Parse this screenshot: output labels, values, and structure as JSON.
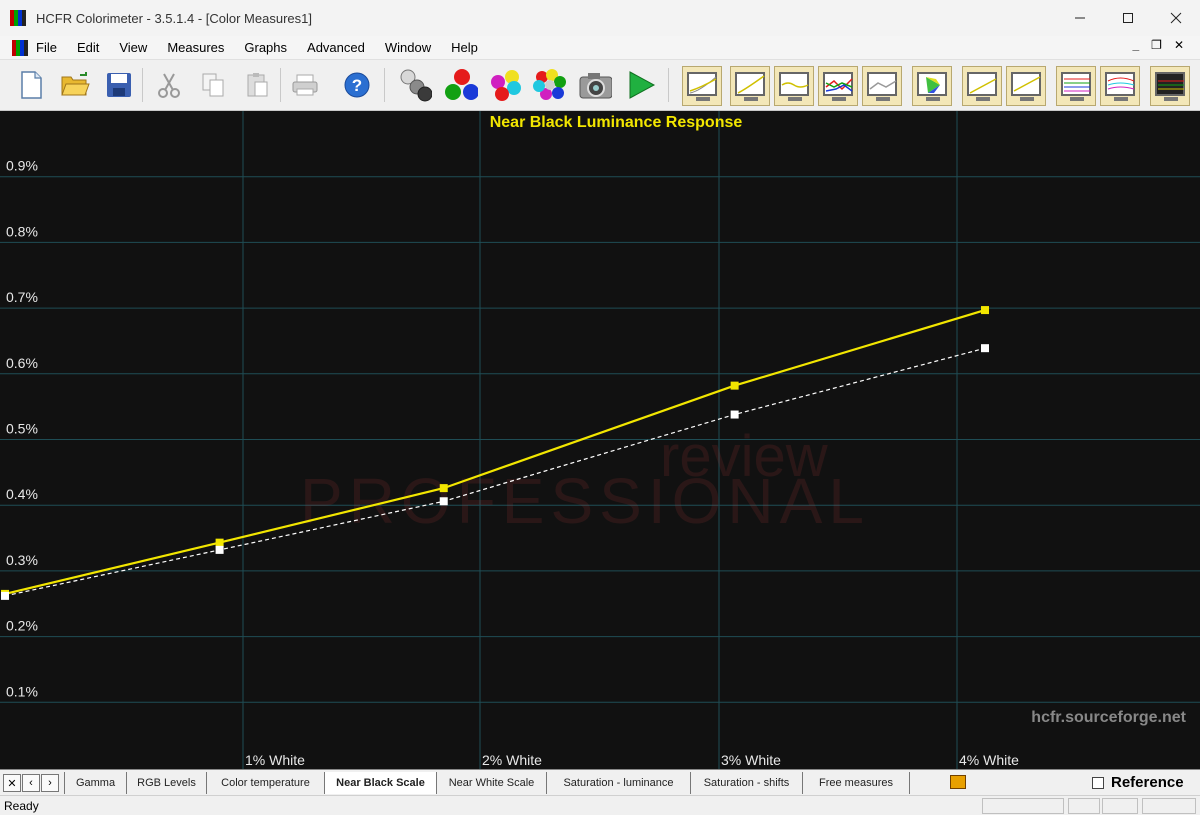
{
  "window": {
    "title": "HCFR Colorimeter - 3.5.1.4 - [Color Measures1]",
    "controls": [
      "minimize-icon",
      "maximize-icon",
      "close-icon"
    ]
  },
  "menu": {
    "items": [
      "File",
      "Edit",
      "View",
      "Measures",
      "Graphs",
      "Advanced",
      "Window",
      "Help"
    ]
  },
  "toolbar": {
    "buttons": [
      "new-icon",
      "open-icon",
      "save-icon",
      "cut-icon",
      "copy-icon",
      "paste-icon",
      "print-icon",
      "help-icon",
      "grayscale-measure-icon",
      "primary-colors-icon",
      "secondary-colors-icon",
      "all-colors-icon",
      "camera-icon",
      "play-icon"
    ],
    "graph_buttons": [
      "gamma-graph-icon",
      "luminance-graph-icon",
      "color-temp-graph-icon",
      "rgb-levels-graph-icon",
      "delta-e-graph-icon",
      "cie-chart-icon",
      "near-black-graph-icon",
      "near-white-graph-icon",
      "saturation-luminance-graph-icon",
      "saturation-shift-graph-icon",
      "free-measures-graph-icon"
    ]
  },
  "chart_data": {
    "type": "line",
    "title": "Near Black Luminance Response",
    "x": [
      0,
      1,
      2,
      3,
      4
    ],
    "xlabels": [
      "1% White",
      "2% White",
      "3% White",
      "4% White"
    ],
    "xlabel_positions": [
      1,
      2,
      3,
      4
    ],
    "yticks": [
      "0.1%",
      "0.2%",
      "0.3%",
      "0.4%",
      "0.5%",
      "0.6%",
      "0.7%",
      "0.8%",
      "0.9%"
    ],
    "ylim": [
      0,
      1.0
    ],
    "xlim": [
      0,
      5
    ],
    "grid": true,
    "series": [
      {
        "color": "#f2e600",
        "style": "solid",
        "points": [
          [
            0,
            0.265
          ],
          [
            0.9,
            0.343
          ],
          [
            1.84,
            0.426
          ],
          [
            3.06,
            0.582
          ],
          [
            4.11,
            0.697
          ]
        ]
      },
      {
        "color": "#ffffff",
        "style": "dashed",
        "points": [
          [
            0,
            0.262
          ],
          [
            0.9,
            0.332
          ],
          [
            1.84,
            0.406
          ],
          [
            3.06,
            0.538
          ],
          [
            4.11,
            0.639
          ]
        ]
      }
    ],
    "watermark": "hcfr.sourceforge.net"
  },
  "tabs": {
    "items": [
      "Gamma",
      "RGB Levels",
      "Color temperature",
      "Near Black Scale",
      "Near White Scale",
      "Saturation - luminance",
      "Saturation - shifts",
      "Free measures"
    ],
    "active": "Near Black Scale",
    "reference_label": "Reference"
  },
  "status": {
    "text": "Ready"
  }
}
